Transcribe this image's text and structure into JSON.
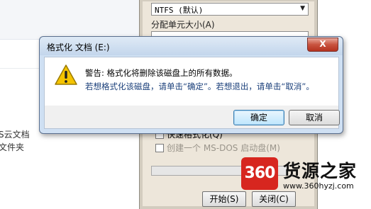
{
  "explorer": {
    "item_1": "S云文档",
    "item_2": "文件夹"
  },
  "format_dialog": {
    "filesystem_value": "NTFS (默认)",
    "alloc_label": "分配单元大小(A)",
    "quick_format_label": "快速格式化(Q)",
    "msdos_label": "创建一个 MS-DOS 启动盘(M)",
    "start_button": "开始(S)",
    "close_button": "关闭(C)"
  },
  "warning_dialog": {
    "title": "格式化 文档 (E:)",
    "close_glyph": "X",
    "message_line1": "警告: 格式化将删除该磁盘上的所有数据。",
    "message_line2": "若想格式化该磁盘，请单击“确定”。若想退出，请单击“取消”。",
    "ok_button": "确定",
    "cancel_button": "取消"
  },
  "watermark": {
    "logo_text": "360",
    "brand": "货源之家",
    "url": "www.360hyzj.com"
  }
}
